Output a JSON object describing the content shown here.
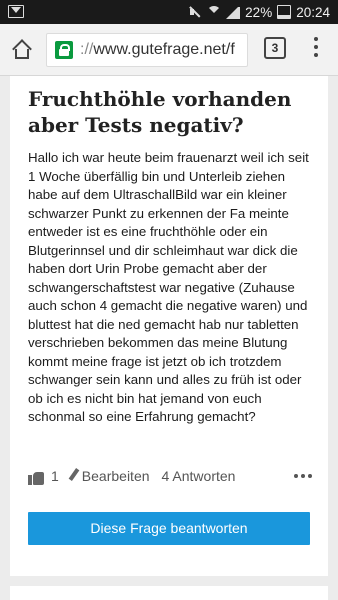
{
  "status_bar": {
    "battery_percent": "22%",
    "time": "20:24"
  },
  "browser": {
    "url_dim": "://",
    "url_main": "www.gutefrage.net/f",
    "tab_count": "3"
  },
  "question": {
    "title": "Fruchthöhle vorhanden aber Tests negativ?",
    "body": "Hallo ich war heute beim frauenarzt weil ich seit 1 Woche überfällig bin und Unterleib ziehen habe auf dem UltraschallBild war ein kleiner schwarzer Punkt zu erkennen der Fa meinte entweder ist es eine fruchthöhle oder ein Blutgerinnsel und dir schleimhaut war dick die haben dort Urin Probe gemacht aber der schwangerschaftstest war negative (Zuhause auch schon 4 gemacht die negative waren) und bluttest hat die ned gemacht hab nur tabletten verschrieben bekommen das meine Blutung kommt meine frage ist jetzt ob ich trotzdem schwanger sein kann und alles zu früh ist oder ob ich es nicht bin hat jemand von euch schonmal so eine Erfahrung gemacht?",
    "likes": "1",
    "edit_label": "Bearbeiten",
    "answers_label": "4 Antworten",
    "answer_button": "Diese Frage beantworten"
  },
  "colors": {
    "accent": "#1a97dc",
    "secure": "#0a9a3f"
  }
}
